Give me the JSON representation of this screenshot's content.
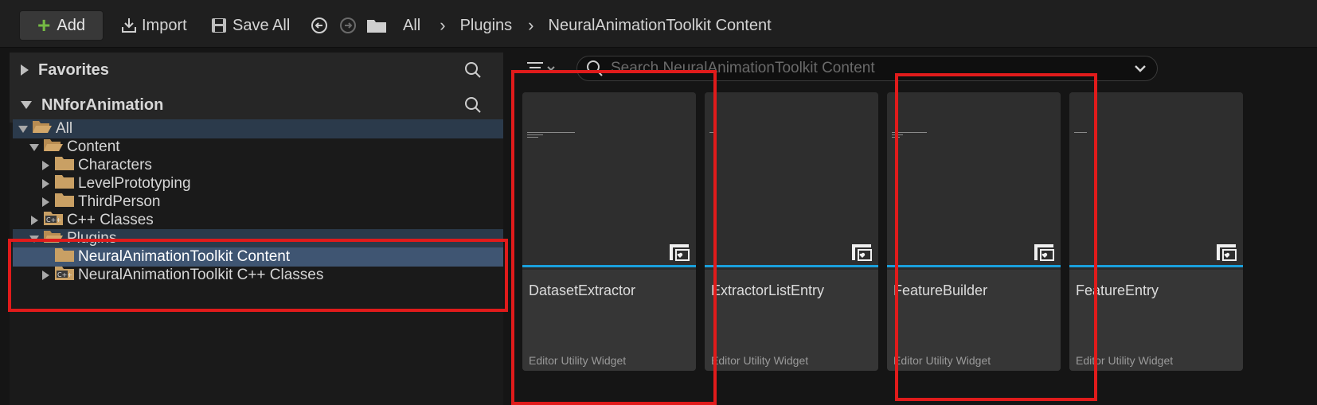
{
  "toolbar": {
    "add_label": "Add",
    "import_label": "Import",
    "save_all_label": "Save All",
    "breadcrumbs": [
      "All",
      "Plugins",
      "NeuralAnimationToolkit Content"
    ]
  },
  "sources": {
    "favorites_label": "Favorites",
    "project_label": "NNforAnimation",
    "tree": [
      {
        "label": "All"
      },
      {
        "label": "Content"
      },
      {
        "label": "Characters"
      },
      {
        "label": "LevelPrototyping"
      },
      {
        "label": "ThirdPerson"
      },
      {
        "label": "C++ Classes"
      },
      {
        "label": "Plugins"
      },
      {
        "label": "NeuralAnimationToolkit Content"
      },
      {
        "label": "NeuralAnimationToolkit C++ Classes"
      }
    ]
  },
  "content": {
    "search_placeholder": "Search NeuralAnimationToolkit Content",
    "assets": [
      {
        "name": "DatasetExtractor",
        "type": "Editor Utility Widget"
      },
      {
        "name": "ExtractorListEntry",
        "type": "Editor Utility Widget"
      },
      {
        "name": "FeatureBuilder",
        "type": "Editor Utility Widget"
      },
      {
        "name": "FeatureEntry",
        "type": "Editor Utility Widget"
      }
    ]
  },
  "colors": {
    "accent_blue": "#1aa0dc",
    "selection": "#3f5572",
    "folder": "#c9a064",
    "highlight_red": "#e01b1b",
    "add_green": "#75b944"
  }
}
